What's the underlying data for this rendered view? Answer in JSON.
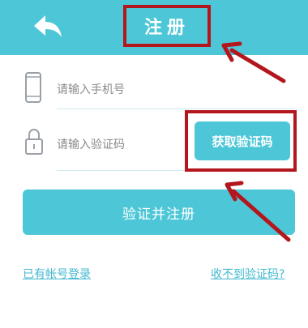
{
  "header": {
    "title": "注册",
    "back_icon": "back-arrow-icon",
    "background": "#4dc7d7"
  },
  "form": {
    "phone": {
      "icon": "phone-icon",
      "placeholder": "请输入手机号",
      "value": ""
    },
    "code": {
      "icon": "lock-icon",
      "placeholder": "请输入验证码",
      "value": "",
      "get_code_label": "获取验证码"
    },
    "submit_label": "验证并注册"
  },
  "links": {
    "login": "已有帐号登录",
    "no_code": "收不到验证码?"
  },
  "colors": {
    "accent": "#4dc7d7",
    "annotation": "#b3171d",
    "link": "#43b8cf"
  }
}
